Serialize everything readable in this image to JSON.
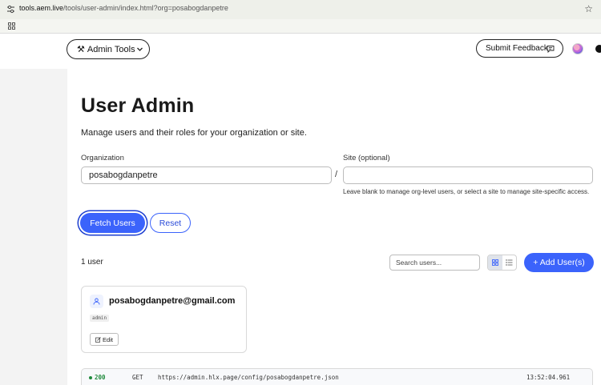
{
  "browser": {
    "url_host": "tools.aem.live",
    "url_path": "/tools/user-admin/index.html?org=posabogdanpetre"
  },
  "header": {
    "tools_menu_label": "Admin Tools",
    "tools_menu_glyph": "⚒",
    "feedback_label": "Submit Feedback"
  },
  "page": {
    "title": "User Admin",
    "subtitle": "Manage users and their roles for your organization or site."
  },
  "form": {
    "org_label": "Organization",
    "org_value": "posabogdanpetre",
    "separator": "/",
    "site_label": "Site (optional)",
    "site_value": "",
    "site_hint": "Leave blank to manage org-level users, or select a site to manage site-specific access.",
    "fetch_label": "Fetch Users",
    "reset_label": "Reset"
  },
  "toolbar": {
    "count_text": "1 user",
    "search_placeholder": "Search users...",
    "add_label": "+ Add User(s)",
    "active_view": "grid"
  },
  "users": [
    {
      "email": "posabogdanpetre@gmail.com",
      "role": "admin",
      "edit_label": "Edit"
    }
  ],
  "log": {
    "status": "200",
    "method": "GET",
    "url": "https://admin.hlx.page/config/posabogdanpetre.json",
    "time": "13:52:04.961"
  },
  "colors": {
    "accent": "#3b63fb",
    "status_ok": "#1f8a3c"
  }
}
